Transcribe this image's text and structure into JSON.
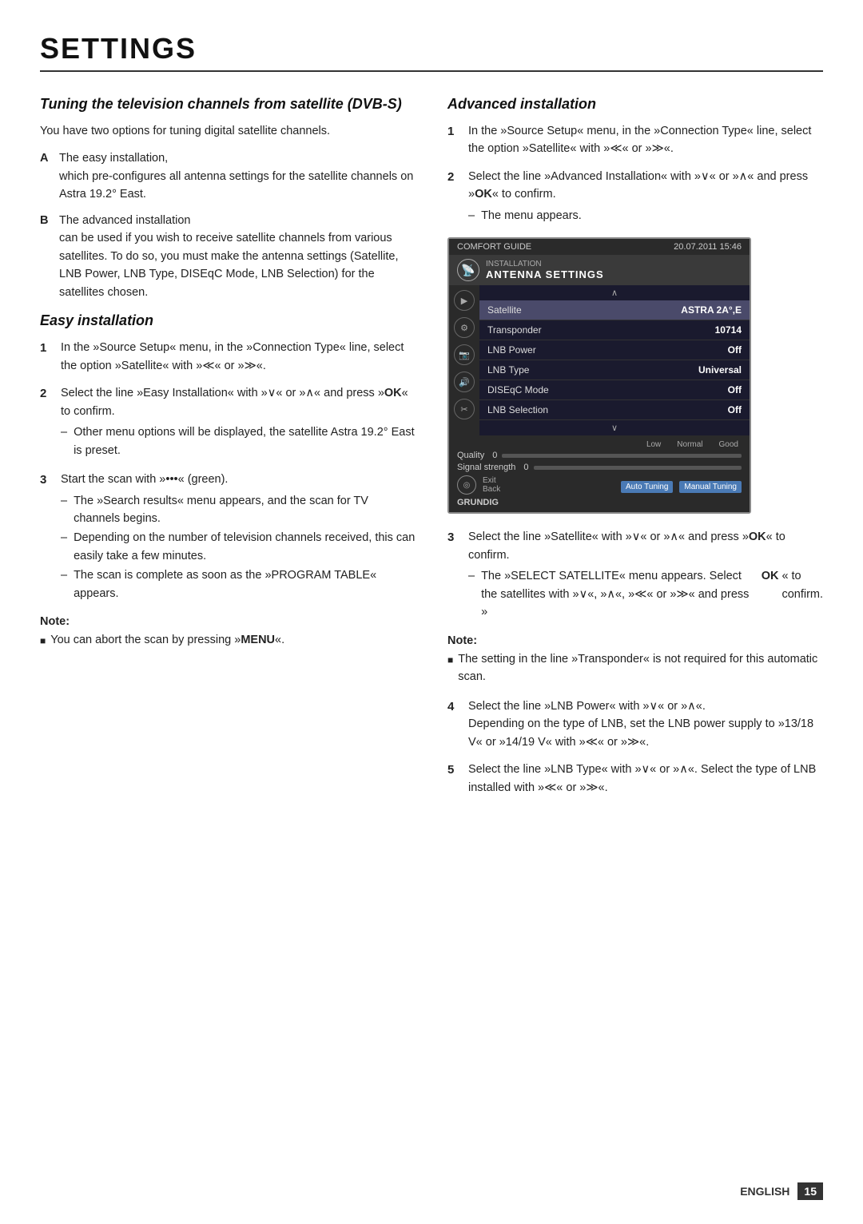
{
  "page": {
    "title": "SETTINGS",
    "footer": {
      "lang": "ENGLISH",
      "page_num": "15"
    }
  },
  "left_col": {
    "main_heading": "Tuning the television channels from satellite (DVB-S)",
    "intro": "You have two options for tuning digital satellite channels.",
    "options": [
      {
        "label": "A",
        "text": "The easy installation,",
        "sub": "which pre-configures all antenna settings for the satellite channels on Astra 19.2° East."
      },
      {
        "label": "B",
        "text": "The advanced installation",
        "sub": "can be used if you wish to receive satellite channels from various satellites. To do so, you must make the antenna settings (Satellite, LNB Power, LNB Type, DISEqC Mode, LNB Selection) for the satellites chosen."
      }
    ],
    "easy_heading": "Easy installation",
    "easy_steps": [
      {
        "num": "1",
        "text": "In the »Source Setup« menu, in the »Connection Type« line, select the option »Satellite« with »≪« or »≫«."
      },
      {
        "num": "2",
        "text": "Select the line »Easy Installation« with »∨« or »∧« and press »OK« to confirm.",
        "subs": [
          "Other menu options will be displayed, the satellite Astra 19.2° East is preset."
        ]
      },
      {
        "num": "3",
        "text": "Start the scan with »•••« (green).",
        "subs": [
          "The »Search results« menu appears, and the scan for TV channels begins.",
          "Depending on the number of television channels received, this can easily take a few minutes.",
          "The scan is complete as soon as the »PROGRAM TABLE« appears."
        ]
      }
    ],
    "easy_note_label": "Note:",
    "easy_note_items": [
      "You can abort the scan by pressing »MENU«."
    ]
  },
  "right_col": {
    "adv_heading": "Advanced installation",
    "adv_steps": [
      {
        "num": "1",
        "text": "In the »Source Setup« menu, in the »Connection Type« line, select the option »Satellite« with »≪« or »≫«."
      },
      {
        "num": "2",
        "text": "Select the line »Advanced Installation« with »∨« or »∧« and press »OK« to confirm.",
        "subs": [
          "The menu appears."
        ]
      }
    ],
    "tv_screen": {
      "top_left": "COMFORT GUIDE",
      "top_section": "INSTALLATION",
      "top_title": "ANTENNA SETTINGS",
      "top_right": "20.07.2011 15:46",
      "rows": [
        {
          "label": "Satellite",
          "value": "ASTRA 2A°,E",
          "selected": true
        },
        {
          "label": "Transponder",
          "value": "10714",
          "selected": false
        },
        {
          "label": "LNB Power",
          "value": "Off",
          "selected": false
        },
        {
          "label": "LNB Type",
          "value": "Universal",
          "selected": false
        },
        {
          "label": "DISEqC Mode",
          "value": "Off",
          "selected": false
        },
        {
          "label": "LNB Selection",
          "value": "Off",
          "selected": false
        }
      ],
      "quality_label": "Quality",
      "signal_label": "Signal strength",
      "bar_labels": [
        "Low",
        "Normal",
        "Good"
      ],
      "exit_label": "Exit",
      "back_label": "Back",
      "btn_auto": "Auto Tuning",
      "btn_manual": "Manual Tuning",
      "brand": "GRUNDIG"
    },
    "adv_steps2": [
      {
        "num": "3",
        "text": "Select the line »Satellite« with »∨« or »∧« and press »OK« to confirm.",
        "subs": [
          "The »SELECT SATELLITE« menu appears. Select the satellites with »∨«, »∧«, »≪« or »≫« and press »OK« to confirm."
        ]
      }
    ],
    "adv_note2_label": "Note:",
    "adv_note2_items": [
      "The setting in the line »Transponder« is not required for this automatic scan."
    ],
    "adv_steps3": [
      {
        "num": "4",
        "text": "Select the line »LNB Power« with »∨« or »∧«.",
        "sub2": "Depending on the type of LNB, set the LNB power supply to »13/18 V« or »14/19 V« with »≪« or »≫«."
      },
      {
        "num": "5",
        "text": "Select the line »LNB Type« with »∨« or »∧«. Select the type of LNB installed with »≪« or »≫«."
      }
    ]
  }
}
